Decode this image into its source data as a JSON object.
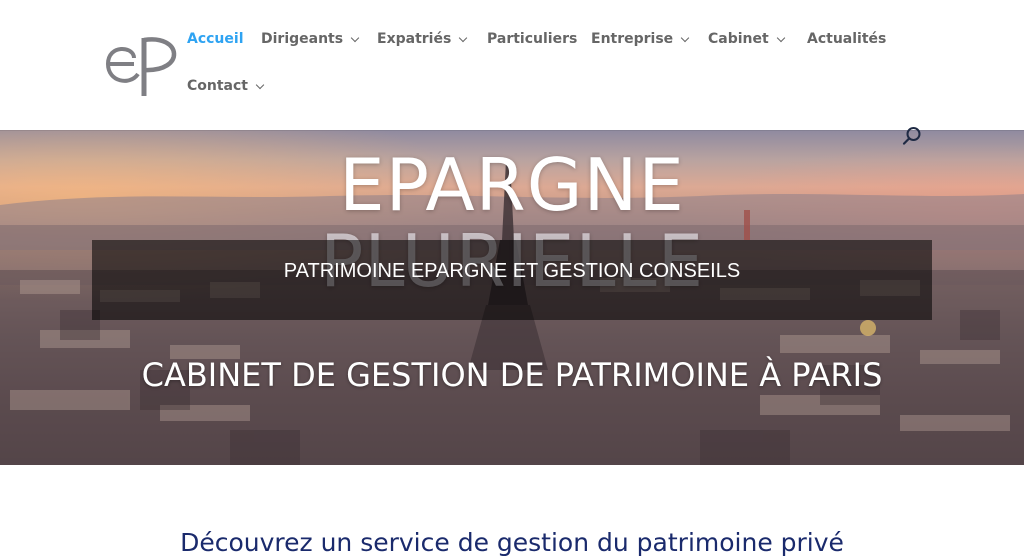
{
  "brand": {
    "logo_text": "eP"
  },
  "nav": {
    "items": [
      {
        "label": "Accueil",
        "active": true,
        "has_submenu": false
      },
      {
        "label": "Dirigeants",
        "active": false,
        "has_submenu": true
      },
      {
        "label": "Expatriés",
        "active": false,
        "has_submenu": true
      },
      {
        "label": "Particuliers",
        "active": false,
        "has_submenu": false
      },
      {
        "label": "Entreprise",
        "active": false,
        "has_submenu": true
      },
      {
        "label": "Cabinet",
        "active": false,
        "has_submenu": true
      },
      {
        "label": "Actualités",
        "active": false,
        "has_submenu": false
      },
      {
        "label": "Contact",
        "active": false,
        "has_submenu": true
      }
    ],
    "search_icon": "search-icon"
  },
  "hero": {
    "title_line1": "EPARGNE",
    "title_line2": "PLURIELLE",
    "banner_text": "PATRIMOINE EPARGNE ET GESTION CONSEILS",
    "subtitle": "CABINET DE GESTION DE PATRIMOINE À PARIS"
  },
  "intro": {
    "heading": "Découvrez un service de gestion du patrimoine privé"
  },
  "colors": {
    "accent": "#2ea3f2",
    "nav_text": "#666666",
    "heading_navy": "#1a2a6c"
  }
}
